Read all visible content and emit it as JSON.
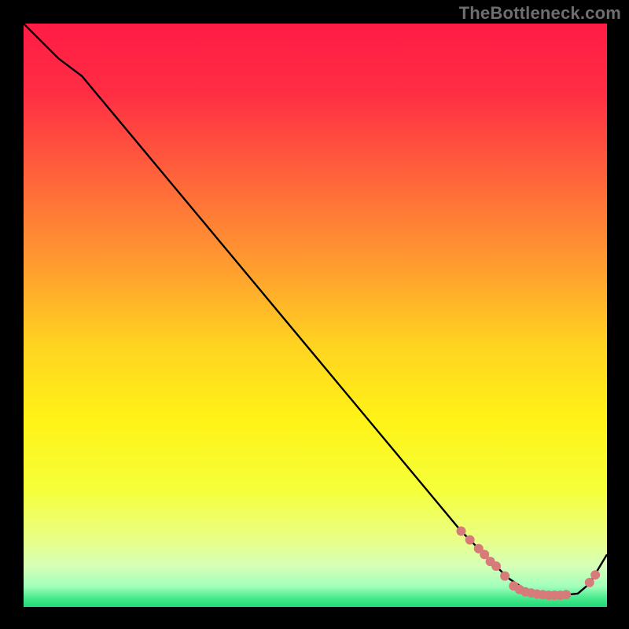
{
  "watermark": "TheBottleneck.com",
  "chart_data": {
    "type": "line",
    "title": "",
    "xlabel": "",
    "ylabel": "",
    "xlim": [
      0,
      100
    ],
    "ylim": [
      0,
      100
    ],
    "grid": false,
    "legend": false,
    "background_gradient": {
      "stops": [
        {
          "offset": 0.0,
          "color": "#ff1b45"
        },
        {
          "offset": 0.12,
          "color": "#ff2e44"
        },
        {
          "offset": 0.28,
          "color": "#ff6a3a"
        },
        {
          "offset": 0.42,
          "color": "#ff9e2f"
        },
        {
          "offset": 0.55,
          "color": "#ffd321"
        },
        {
          "offset": 0.68,
          "color": "#fff317"
        },
        {
          "offset": 0.8,
          "color": "#f5ff3a"
        },
        {
          "offset": 0.88,
          "color": "#eaff82"
        },
        {
          "offset": 0.93,
          "color": "#d6ffb8"
        },
        {
          "offset": 0.965,
          "color": "#a1ffba"
        },
        {
          "offset": 0.985,
          "color": "#47e98d"
        },
        {
          "offset": 1.0,
          "color": "#1fd877"
        }
      ]
    },
    "series": [
      {
        "name": "bottleneck-curve",
        "color": "#000000",
        "x": [
          0,
          3,
          6,
          10,
          15,
          20,
          25,
          30,
          35,
          40,
          45,
          50,
          55,
          60,
          65,
          70,
          75,
          78,
          80,
          83,
          86,
          89,
          92,
          95,
          97,
          100
        ],
        "y": [
          100,
          97,
          94,
          91,
          85,
          79,
          73,
          67,
          61,
          55,
          49,
          43,
          37,
          31,
          25,
          19,
          13,
          10,
          8,
          5,
          3,
          2.2,
          2.0,
          2.3,
          4,
          9
        ]
      }
    ],
    "markers": {
      "name": "highlight-points",
      "color": "#d67a7a",
      "radius": 6,
      "points": [
        {
          "x": 75.0,
          "y": 13.0
        },
        {
          "x": 76.5,
          "y": 11.5
        },
        {
          "x": 78.0,
          "y": 10.0
        },
        {
          "x": 79.0,
          "y": 9.0
        },
        {
          "x": 80.0,
          "y": 7.8
        },
        {
          "x": 81.0,
          "y": 7.0
        },
        {
          "x": 82.5,
          "y": 5.3
        },
        {
          "x": 84.0,
          "y": 3.6
        },
        {
          "x": 85.0,
          "y": 3.0
        },
        {
          "x": 86.0,
          "y": 2.6
        },
        {
          "x": 87.0,
          "y": 2.4
        },
        {
          "x": 88.0,
          "y": 2.2
        },
        {
          "x": 89.0,
          "y": 2.1
        },
        {
          "x": 90.0,
          "y": 2.0
        },
        {
          "x": 91.0,
          "y": 2.0
        },
        {
          "x": 92.0,
          "y": 2.0
        },
        {
          "x": 93.0,
          "y": 2.1
        },
        {
          "x": 97.0,
          "y": 4.2
        },
        {
          "x": 98.0,
          "y": 5.5
        }
      ]
    }
  }
}
